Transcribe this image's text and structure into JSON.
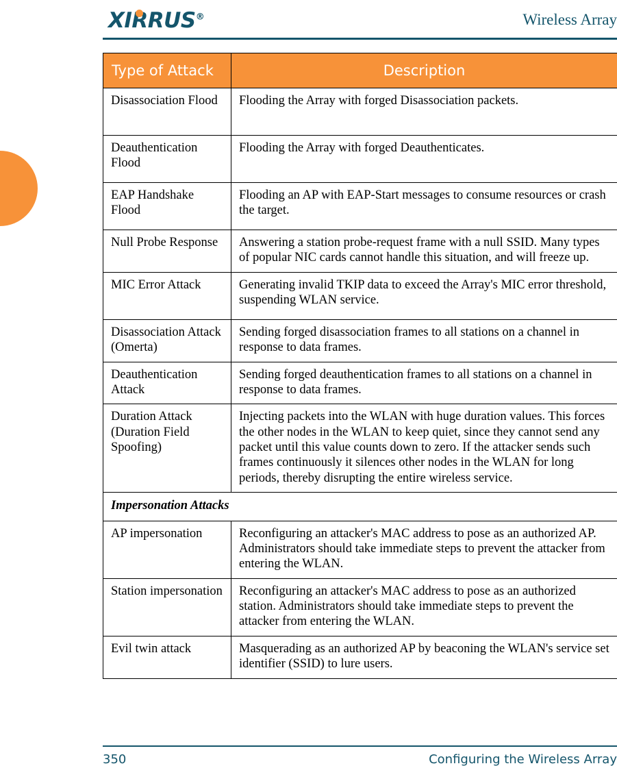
{
  "header": {
    "logo_text": "XIRRUS",
    "logo_registered": "®",
    "title": "Wireless Array"
  },
  "table": {
    "columns": [
      "Type of Attack",
      "Description"
    ],
    "rows": [
      {
        "type": "Disassociation Flood",
        "description": "Flooding the Array with forged Disassociation packets."
      },
      {
        "type": "Deauthentication Flood",
        "description": "Flooding the Array with forged Deauthenticates."
      },
      {
        "type": "EAP Handshake Flood",
        "description": "Flooding an AP with EAP-Start messages to consume resources or crash the target."
      },
      {
        "type": "Null Probe Response",
        "description": "Answering a station probe-request frame with a null SSID. Many types of popular NIC cards cannot handle this situation, and will freeze up."
      },
      {
        "type": "MIC Error Attack",
        "description": "Generating invalid TKIP data to exceed the Array's MIC error threshold, suspending WLAN service."
      },
      {
        "type": "Disassociation Attack (Omerta)",
        "description": "Sending forged disassociation frames to all stations on a channel in response to data frames."
      },
      {
        "type": "Deauthentication Attack",
        "description": "Sending forged deauthentication frames to all stations on a channel in response to data frames."
      },
      {
        "type": "Duration Attack (Duration Field Spoofing)",
        "description": "Injecting packets into the WLAN with huge duration values. This forces the other nodes in the WLAN to keep quiet, since they cannot send any packet until this value counts down to zero. If the attacker sends such frames continuously it silences other nodes in the WLAN for long periods, thereby disrupting the entire wireless service."
      }
    ],
    "section_header": "Impersonation Attacks",
    "impersonation_rows": [
      {
        "type": "AP impersonation",
        "description": "Reconfiguring an attacker's MAC address to pose as an authorized AP. Administrators should take immediate steps to prevent the attacker from entering the WLAN."
      },
      {
        "type": "Station impersonation",
        "description": "Reconfiguring an attacker's MAC address to pose as an authorized station. Administrators should take immediate steps to prevent the attacker from entering the WLAN."
      },
      {
        "type": "Evil twin attack",
        "description": "Masquerading as an authorized AP by beaconing the WLAN's service set identifier (SSID) to lure users."
      }
    ]
  },
  "footer": {
    "page_number": "350",
    "section_title": "Configuring the Wireless Array"
  },
  "colors": {
    "accent_orange": "#F79239",
    "brand_teal": "#14556B"
  }
}
